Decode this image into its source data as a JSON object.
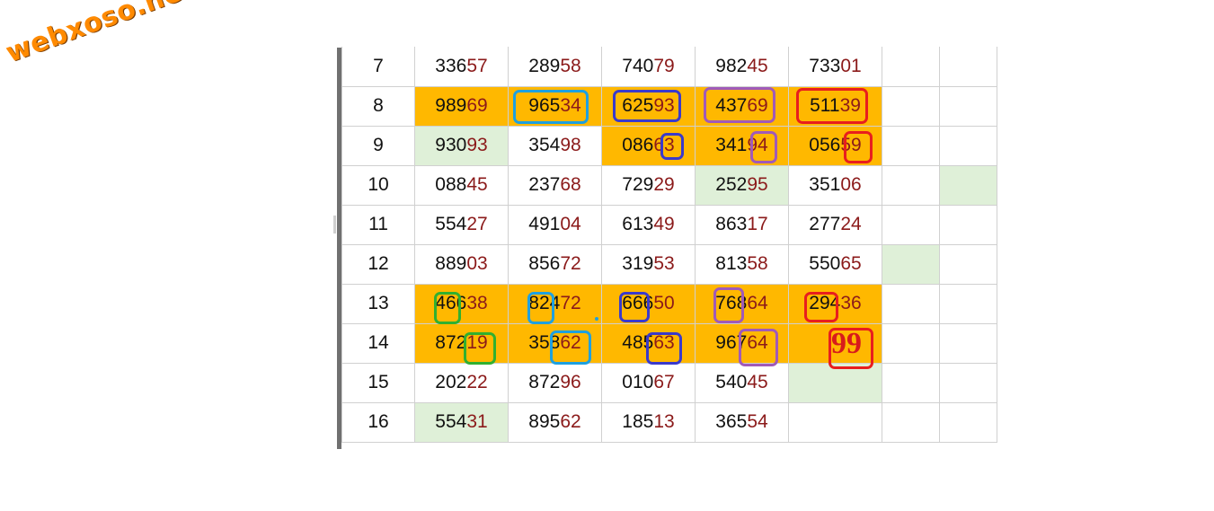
{
  "logo": {
    "text": "webxoso.net"
  },
  "table": {
    "rows": [
      {
        "num": "7",
        "cells": [
          {
            "h": "336",
            "t": "57"
          },
          {
            "h": "289",
            "t": "58"
          },
          {
            "h": "740",
            "t": "79"
          },
          {
            "h": "982",
            "t": "45"
          },
          {
            "h": "733",
            "t": "01"
          },
          {
            "h": "",
            "t": ""
          },
          {
            "h": "",
            "t": ""
          }
        ]
      },
      {
        "num": "8",
        "cells": [
          {
            "h": "989",
            "t": "69"
          },
          {
            "h": "965",
            "t": "34"
          },
          {
            "h": "625",
            "t": "93"
          },
          {
            "h": "437",
            "t": "69"
          },
          {
            "h": "511",
            "t": "39"
          },
          {
            "h": "",
            "t": ""
          },
          {
            "h": "",
            "t": ""
          }
        ]
      },
      {
        "num": "9",
        "cells": [
          {
            "h": "930",
            "t": "93"
          },
          {
            "h": "354",
            "t": "98"
          },
          {
            "h": "086",
            "t": "63"
          },
          {
            "h": "341",
            "t": "94"
          },
          {
            "h": "056",
            "t": "59"
          },
          {
            "h": "",
            "t": ""
          },
          {
            "h": "",
            "t": ""
          }
        ]
      },
      {
        "num": "10",
        "cells": [
          {
            "h": "088",
            "t": "45"
          },
          {
            "h": "237",
            "t": "68"
          },
          {
            "h": "729",
            "t": "29"
          },
          {
            "h": "252",
            "t": "95"
          },
          {
            "h": "351",
            "t": "06"
          },
          {
            "h": "",
            "t": ""
          },
          {
            "h": "",
            "t": ""
          }
        ]
      },
      {
        "num": "11",
        "cells": [
          {
            "h": "554",
            "t": "27"
          },
          {
            "h": "491",
            "t": "04"
          },
          {
            "h": "613",
            "t": "49"
          },
          {
            "h": "863",
            "t": "17"
          },
          {
            "h": "277",
            "t": "24"
          },
          {
            "h": "",
            "t": ""
          },
          {
            "h": "",
            "t": ""
          }
        ]
      },
      {
        "num": "12",
        "cells": [
          {
            "h": "889",
            "t": "03"
          },
          {
            "h": "856",
            "t": "72"
          },
          {
            "h": "319",
            "t": "53"
          },
          {
            "h": "813",
            "t": "58"
          },
          {
            "h": "550",
            "t": "65"
          },
          {
            "h": "",
            "t": ""
          },
          {
            "h": "",
            "t": ""
          }
        ]
      },
      {
        "num": "13",
        "cells": [
          {
            "h": "466",
            "t": "38"
          },
          {
            "h": "824",
            "t": "72"
          },
          {
            "h": "666",
            "t": "50"
          },
          {
            "h": "768",
            "t": "64"
          },
          {
            "h": "294",
            "t": "36"
          },
          {
            "h": "",
            "t": ""
          },
          {
            "h": "",
            "t": ""
          }
        ]
      },
      {
        "num": "14",
        "cells": [
          {
            "h": "872",
            "t": "19"
          },
          {
            "h": "358",
            "t": "62"
          },
          {
            "h": "485",
            "t": "63"
          },
          {
            "h": "967",
            "t": "64"
          },
          {
            "h": "",
            "t": ""
          },
          {
            "h": "",
            "t": ""
          },
          {
            "h": "",
            "t": ""
          }
        ]
      },
      {
        "num": "15",
        "cells": [
          {
            "h": "202",
            "t": "22"
          },
          {
            "h": "872",
            "t": "96"
          },
          {
            "h": "010",
            "t": "67"
          },
          {
            "h": "540",
            "t": "45"
          },
          {
            "h": "",
            "t": ""
          },
          {
            "h": "",
            "t": ""
          },
          {
            "h": "",
            "t": ""
          }
        ]
      },
      {
        "num": "16",
        "cells": [
          {
            "h": "554",
            "t": "31"
          },
          {
            "h": "895",
            "t": "62"
          },
          {
            "h": "185",
            "t": "13"
          },
          {
            "h": "365",
            "t": "54"
          },
          {
            "h": "",
            "t": ""
          },
          {
            "h": "",
            "t": ""
          },
          {
            "h": "",
            "t": ""
          }
        ]
      }
    ],
    "prediction": "99"
  },
  "colors": {
    "highlight_gold": "#ffb800",
    "highlight_green": "#dff0d8",
    "row_number": "#1a1ad6",
    "tail_digits": "#8b1a1a",
    "circle_blue": "#1ea0e0",
    "circle_navy": "#3a3acb",
    "circle_purple": "#a05ab8",
    "circle_red": "#e81e1e",
    "circle_green": "#30b030"
  }
}
